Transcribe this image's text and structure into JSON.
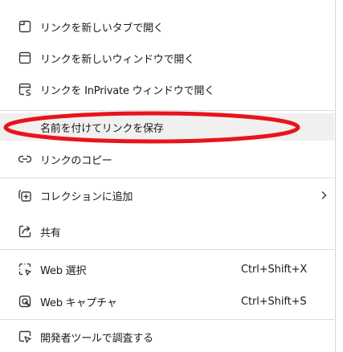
{
  "menu": {
    "items": [
      {
        "label": "リンクを新しいタブで開く",
        "icon": "new-tab-icon"
      },
      {
        "label": "リンクを新しいウィンドウで開く",
        "icon": "new-window-icon"
      },
      {
        "label": "リンクを InPrivate ウィンドウで開く",
        "icon": "inprivate-window-icon"
      },
      {
        "label": "名前を付けてリンクを保存",
        "icon": ""
      },
      {
        "label": "リンクのコピー",
        "icon": "link-icon"
      },
      {
        "label": "コレクションに追加",
        "icon": "collections-add-icon",
        "submenu": true
      },
      {
        "label": "共有",
        "icon": "share-icon"
      },
      {
        "label": "Web 選択",
        "icon": "web-select-icon",
        "shortcut": "Ctrl+Shift+X"
      },
      {
        "label": "Web キャプチャ",
        "icon": "web-capture-icon",
        "shortcut": "Ctrl+Shift+S"
      },
      {
        "label": "開発者ツールで調査する",
        "icon": "devtools-inspect-icon"
      }
    ],
    "highlighted_index": 3
  },
  "annotation": {
    "type": "ellipse",
    "color": "#e8141c",
    "target_index": 3
  },
  "colors": {
    "text": "#1a1a1a",
    "highlight": "#f0f0f0",
    "divider": "#dcdcdc",
    "icon": "#3a3a3a"
  }
}
